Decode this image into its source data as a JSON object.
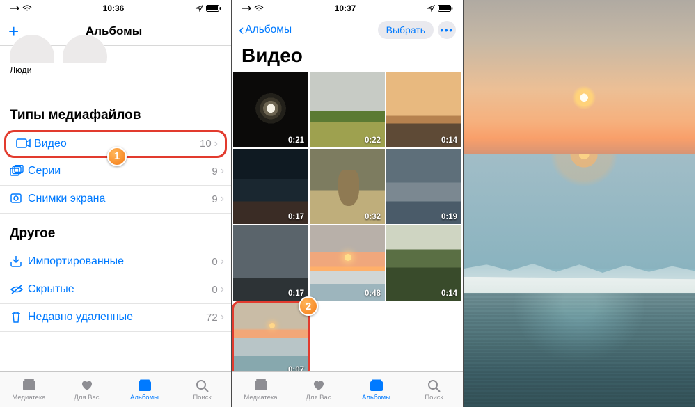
{
  "status": {
    "time1": "10:36",
    "time2": "10:37"
  },
  "panel1": {
    "header_title": "Альбомы",
    "people_label": "Люди",
    "section_media": "Типы медиафайлов",
    "section_other": "Другое",
    "rows_media": [
      {
        "icon": "video",
        "label": "Видео",
        "count": "10"
      },
      {
        "icon": "burst",
        "label": "Серии",
        "count": "9"
      },
      {
        "icon": "screenshot",
        "label": "Снимки экрана",
        "count": "9"
      }
    ],
    "rows_other": [
      {
        "icon": "import",
        "label": "Импортированные",
        "count": "0"
      },
      {
        "icon": "hidden",
        "label": "Скрытые",
        "count": "0"
      },
      {
        "icon": "trash",
        "label": "Недавно удаленные",
        "count": "72"
      }
    ]
  },
  "panel2": {
    "back": "Альбомы",
    "select": "Выбрать",
    "title": "Видео",
    "durations": [
      "0:21",
      "0:22",
      "0:14",
      "0:17",
      "0:32",
      "0:19",
      "0:17",
      "0:48",
      "0:14",
      "0:07"
    ]
  },
  "tabs": {
    "library": "Медиатека",
    "foryou": "Для Вас",
    "albums": "Альбомы",
    "search": "Поиск"
  },
  "annot": {
    "n1": "1",
    "n2": "2"
  }
}
